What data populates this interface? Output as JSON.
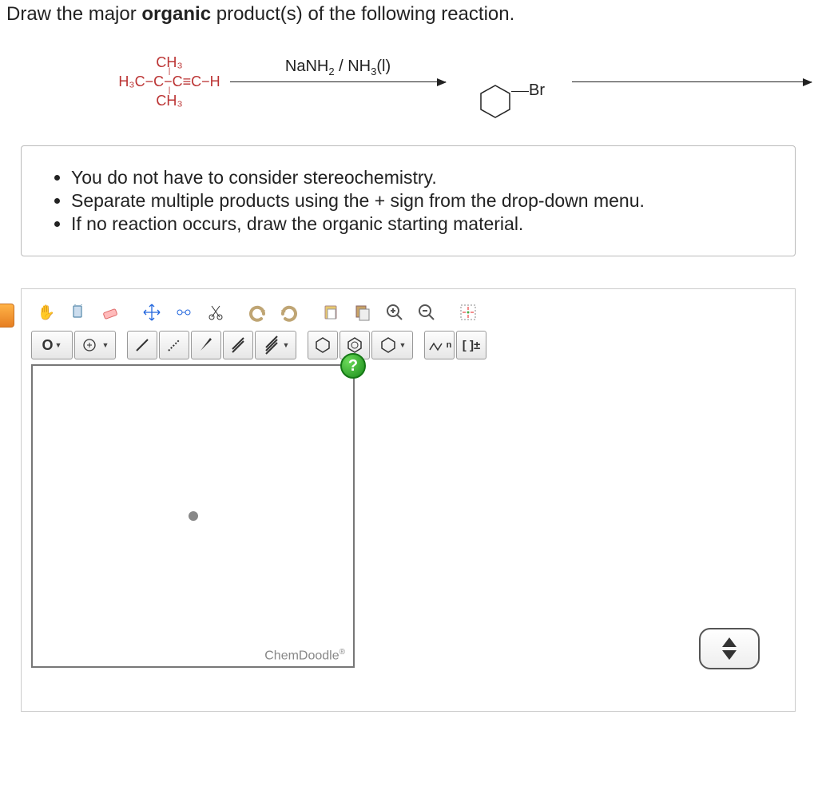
{
  "question": {
    "prefix": "Draw the major ",
    "bold": "organic",
    "suffix": " product(s) of the following reaction."
  },
  "reaction": {
    "molecule_top": "CH₃",
    "molecule_mid": "H₃C−C−C≡C−H",
    "molecule_bot": "CH₃",
    "reagent_html": "NaNH<sub>2</sub> / NH<sub>3</sub>(l)",
    "second_reagent_label": "Br"
  },
  "instructions": [
    "You do not have to consider stereochemistry.",
    "Separate multiple products using the + sign from the drop-down menu.",
    "If no reaction occurs, draw the organic starting material."
  ],
  "toolbar": {
    "atom_label": "O",
    "sn_label": "n",
    "bracket_label": "[ ]±"
  },
  "canvas": {
    "help_label": "?",
    "brand": "ChemDoodle",
    "brand_mark": "®"
  }
}
